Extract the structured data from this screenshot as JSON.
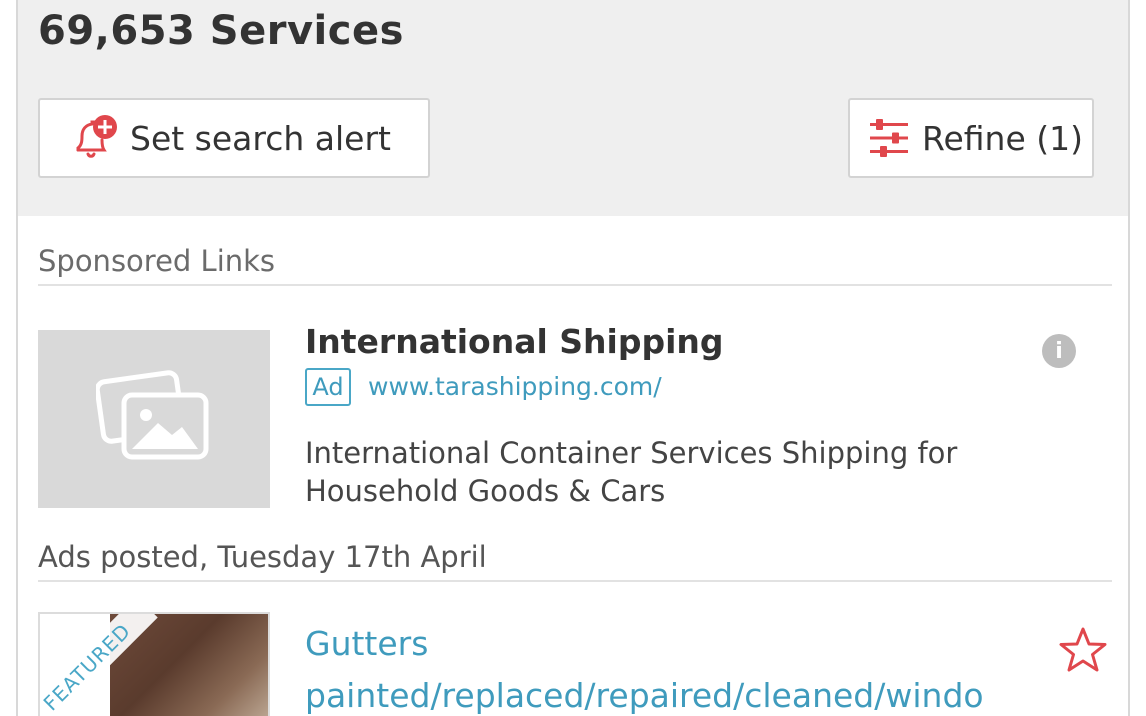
{
  "header": {
    "results_count": "69,653 Services",
    "alert_button_label": "Set search alert",
    "refine_button_label": "Refine (1)"
  },
  "sponsored": {
    "section_label": "Sponsored Links",
    "ad": {
      "title": "International Shipping",
      "badge": "Ad",
      "url": "www.tarashipping.com/",
      "description_line1": "International Container Services Shipping for",
      "description_line2": "Household Goods & Cars",
      "info_icon_glyph": "i"
    }
  },
  "listings": {
    "posted_label": "Ads posted, Tuesday 17th April",
    "items": [
      {
        "ribbon": "FEATURED",
        "title_line1": "Gutters",
        "title_line2": "painted/replaced/repaired/cleaned/windo"
      }
    ]
  },
  "icons": {
    "alert": "bell-plus-icon",
    "refine": "sliders-icon",
    "placeholder": "image-placeholder-icon",
    "info": "info-icon",
    "favorite": "star-outline-icon"
  },
  "colors": {
    "accent_red": "#e0474c",
    "link_blue": "#3f9bbd",
    "panel_gray": "#efefef"
  }
}
